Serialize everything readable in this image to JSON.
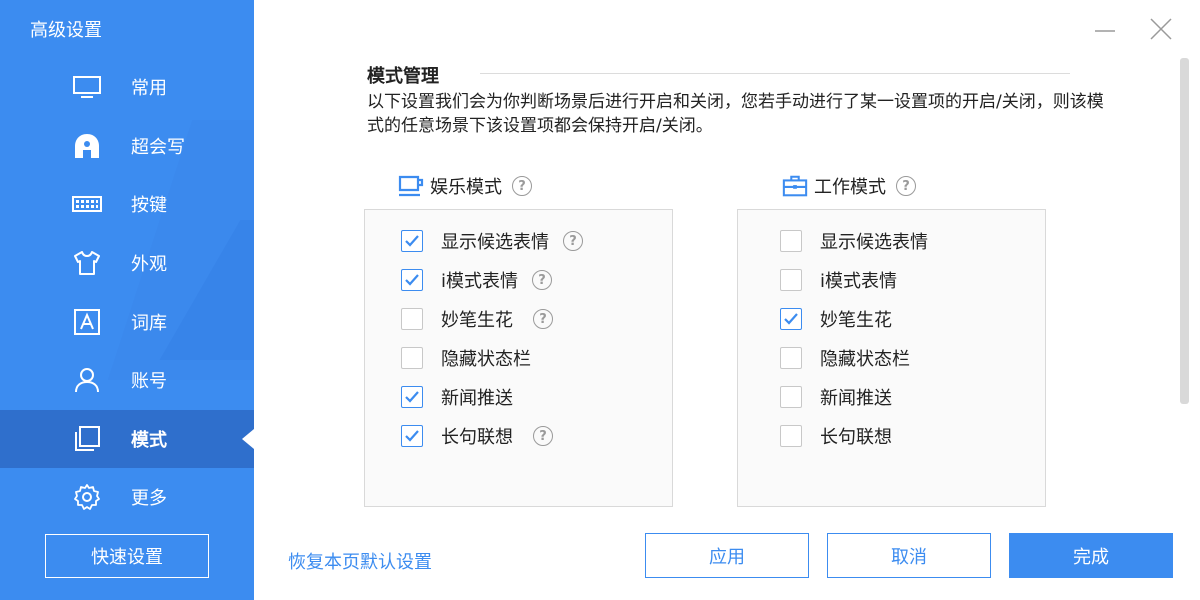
{
  "window": {
    "title": "高级设置"
  },
  "sidebar": {
    "items": [
      {
        "label": "常用",
        "icon": "monitor-icon"
      },
      {
        "label": "超会写",
        "icon": "super-write-icon"
      },
      {
        "label": "按键",
        "icon": "keyboard-icon"
      },
      {
        "label": "外观",
        "icon": "shirt-icon"
      },
      {
        "label": "词库",
        "icon": "lexicon-icon"
      },
      {
        "label": "账号",
        "icon": "user-icon"
      },
      {
        "label": "模式",
        "icon": "mode-icon",
        "active": true
      },
      {
        "label": "更多",
        "icon": "gear-icon"
      }
    ],
    "quick_settings_label": "快速设置"
  },
  "main": {
    "section_title": "模式管理",
    "description": "以下设置我们会为你判断场景后进行开启和关闭，您若手动进行了某一设置项的开启/关闭，则该模式的任意场景下该设置项都会保持开启/关闭。",
    "modes": [
      {
        "name": "娱乐模式",
        "icon": "cup-icon",
        "options": [
          {
            "label": "显示候选表情",
            "checked": true,
            "help": true
          },
          {
            "label": "i模式表情",
            "checked": true,
            "help": true
          },
          {
            "label": "妙笔生花",
            "checked": false,
            "help": true
          },
          {
            "label": "隐藏状态栏",
            "checked": false,
            "help": false
          },
          {
            "label": "新闻推送",
            "checked": true,
            "help": false
          },
          {
            "label": "长句联想",
            "checked": true,
            "help": true
          }
        ]
      },
      {
        "name": "工作模式",
        "icon": "briefcase-icon",
        "options": [
          {
            "label": "显示候选表情",
            "checked": false
          },
          {
            "label": "i模式表情",
            "checked": false
          },
          {
            "label": "妙笔生花",
            "checked": true
          },
          {
            "label": "隐藏状态栏",
            "checked": false
          },
          {
            "label": "新闻推送",
            "checked": false
          },
          {
            "label": "长句联想",
            "checked": false
          }
        ]
      }
    ]
  },
  "footer": {
    "restore_label": "恢复本页默认设置",
    "apply_label": "应用",
    "cancel_label": "取消",
    "done_label": "完成"
  },
  "colors": {
    "accent": "#3c8cf0",
    "sidebar_bg": "#3c8cf0",
    "sidebar_active": "#2f6fcc"
  }
}
